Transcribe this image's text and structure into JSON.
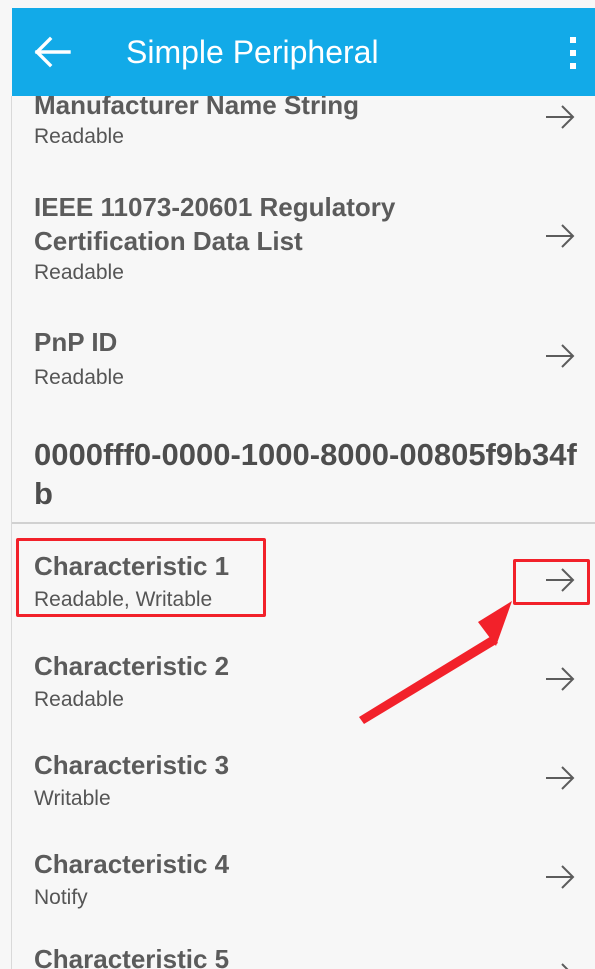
{
  "app_bar": {
    "title": "Simple Peripheral",
    "background": "#12aae8",
    "back_icon": "arrow-left",
    "menu_icon": "more-vertical"
  },
  "list": {
    "previous_items": [
      {
        "title": "Manufacturer Name String",
        "subtitle": "Readable"
      },
      {
        "title_line_1": "IEEE 11073-20601 Regulatory",
        "title_line_2": "Certification Data List",
        "subtitle": "Readable"
      },
      {
        "title": "PnP ID",
        "subtitle": "Readable"
      }
    ],
    "service_uuid": "0000fff0-0000-1000-8000-00805f9b34fb",
    "characteristics": [
      {
        "title": "Characteristic 1",
        "subtitle": "Readable, Writable"
      },
      {
        "title": "Characteristic 2",
        "subtitle": "Readable"
      },
      {
        "title": "Characteristic 3",
        "subtitle": "Writable"
      },
      {
        "title": "Characteristic 4",
        "subtitle": "Notify"
      },
      {
        "title": "Characteristic 5"
      }
    ]
  },
  "annotation": {
    "highlight_color": "#f2212a",
    "icon": "red-pointer-arrow"
  }
}
